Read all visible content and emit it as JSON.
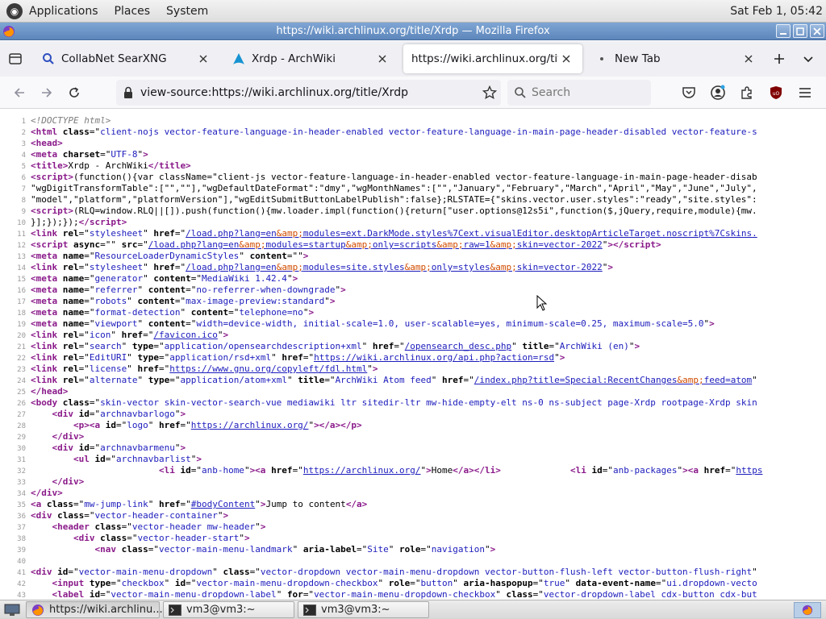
{
  "panel": {
    "menus": [
      "Applications",
      "Places",
      "System"
    ],
    "clock": "Sat Feb  1, 05:42"
  },
  "window": {
    "title": "https://wiki.archlinux.org/title/Xrdp — Mozilla Firefox"
  },
  "tabs": [
    {
      "label": "CollabNet SearXNG",
      "icon": "search-icon",
      "active": false
    },
    {
      "label": "Xrdp - ArchWiki",
      "icon": "archwiki-icon",
      "active": false
    },
    {
      "label": "https://wiki.archlinux.org/title/X",
      "icon": "",
      "active": true
    },
    {
      "label": "New Tab",
      "icon": "dot-icon",
      "active": false
    }
  ],
  "navbar": {
    "url": "view-source:https://wiki.archlinux.org/title/Xrdp",
    "search_placeholder": "Search"
  },
  "source_lines": [
    {
      "n": "1",
      "html": "<span class=\"cmt\">&lt;!DOCTYPE html&gt;</span>"
    },
    {
      "n": "2",
      "html": "<span class=\"tag\">&lt;html</span> <span class=\"attr\">class</span>=\"<span class=\"val\">client-nojs vector-feature-language-in-header-enabled vector-feature-language-in-main-page-header-disabled vector-feature-s</span>"
    },
    {
      "n": "3",
      "html": "<span class=\"tag\">&lt;head&gt;</span>"
    },
    {
      "n": "4",
      "html": "<span class=\"tag\">&lt;meta</span> <span class=\"attr\">charset</span>=\"<span class=\"val\">UTF-8</span>\"<span class=\"tag\">&gt;</span>"
    },
    {
      "n": "5",
      "html": "<span class=\"tag\">&lt;title&gt;</span>Xrdp - ArchWiki<span class=\"tag\">&lt;/title&gt;</span>"
    },
    {
      "n": "6",
      "html": "<span class=\"tag\">&lt;script&gt;</span>(function(){var className=\"client-js vector-feature-language-in-header-enabled vector-feature-language-in-main-page-header-disab"
    },
    {
      "n": "7",
      "html": "\"wgDigitTransformTable\":[\"\",\"\"],\"wgDefaultDateFormat\":\"dmy\",\"wgMonthNames\":[\"\",\"January\",\"February\",\"March\",\"April\",\"May\",\"June\",\"July\","
    },
    {
      "n": "8",
      "html": "\"model\",\"platform\",\"platformVersion\"],\"wgEditSubmitButtonLabelPublish\":false};RLSTATE={\"skins.vector.user.styles\":\"ready\",\"site.styles\":"
    },
    {
      "n": "9",
      "html": "<span class=\"tag\">&lt;script&gt;</span>(RLQ=window.RLQ||[]).push(function(){mw.loader.impl(function(){return[\"user.options@12s5i\",function($,jQuery,require,module){mw."
    },
    {
      "n": "10",
      "html": "}];});});<span class=\"tag\">&lt;/script&gt;</span>"
    },
    {
      "n": "11",
      "html": "<span class=\"tag\">&lt;link</span> <span class=\"attr\">rel</span>=\"<span class=\"val\">stylesheet</span>\" <span class=\"attr\">href</span>=\"<span class=\"link\">/load.php?lang=en<span class=\"ent\">&amp;amp;</span>modules=ext.DarkMode.styles%7Cext.visualEditor.desktopArticleTarget.noscript%7Cskins.</span>"
    },
    {
      "n": "12",
      "html": "<span class=\"tag\">&lt;script</span> <span class=\"attr\">async</span>=\"\" <span class=\"attr\">src</span>=\"<span class=\"link\">/load.php?lang=en<span class=\"ent\">&amp;amp;</span>modules=startup<span class=\"ent\">&amp;amp;</span>only=scripts<span class=\"ent\">&amp;amp;</span>raw=1<span class=\"ent\">&amp;amp;</span>skin=vector-2022</span>\"<span class=\"tag\">&gt;&lt;/script&gt;</span>"
    },
    {
      "n": "13",
      "html": "<span class=\"tag\">&lt;meta</span> <span class=\"attr\">name</span>=\"<span class=\"val\">ResourceLoaderDynamicStyles</span>\" <span class=\"attr\">content</span>=\"\"<span class=\"tag\">&gt;</span>"
    },
    {
      "n": "14",
      "html": "<span class=\"tag\">&lt;link</span> <span class=\"attr\">rel</span>=\"<span class=\"val\">stylesheet</span>\" <span class=\"attr\">href</span>=\"<span class=\"link\">/load.php?lang=en<span class=\"ent\">&amp;amp;</span>modules=site.styles<span class=\"ent\">&amp;amp;</span>only=styles<span class=\"ent\">&amp;amp;</span>skin=vector-2022</span>\"<span class=\"tag\">&gt;</span>"
    },
    {
      "n": "15",
      "html": "<span class=\"tag\">&lt;meta</span> <span class=\"attr\">name</span>=\"<span class=\"val\">generator</span>\" <span class=\"attr\">content</span>=\"<span class=\"val\">MediaWiki 1.42.4</span>\"<span class=\"tag\">&gt;</span>"
    },
    {
      "n": "16",
      "html": "<span class=\"tag\">&lt;meta</span> <span class=\"attr\">name</span>=\"<span class=\"val\">referrer</span>\" <span class=\"attr\">content</span>=\"<span class=\"val\">no-referrer-when-downgrade</span>\"<span class=\"tag\">&gt;</span>"
    },
    {
      "n": "17",
      "html": "<span class=\"tag\">&lt;meta</span> <span class=\"attr\">name</span>=\"<span class=\"val\">robots</span>\" <span class=\"attr\">content</span>=\"<span class=\"val\">max-image-preview:standard</span>\"<span class=\"tag\">&gt;</span>"
    },
    {
      "n": "18",
      "html": "<span class=\"tag\">&lt;meta</span> <span class=\"attr\">name</span>=\"<span class=\"val\">format-detection</span>\" <span class=\"attr\">content</span>=\"<span class=\"val\">telephone=no</span>\"<span class=\"tag\">&gt;</span>"
    },
    {
      "n": "19",
      "html": "<span class=\"tag\">&lt;meta</span> <span class=\"attr\">name</span>=\"<span class=\"val\">viewport</span>\" <span class=\"attr\">content</span>=\"<span class=\"val\">width=device-width, initial-scale=1.0, user-scalable=yes, minimum-scale=0.25, maximum-scale=5.0</span>\"<span class=\"tag\">&gt;</span>"
    },
    {
      "n": "20",
      "html": "<span class=\"tag\">&lt;link</span> <span class=\"attr\">rel</span>=\"<span class=\"val\">icon</span>\" <span class=\"attr\">href</span>=\"<span class=\"link\">/favicon.ico</span>\"<span class=\"tag\">&gt;</span>"
    },
    {
      "n": "21",
      "html": "<span class=\"tag\">&lt;link</span> <span class=\"attr\">rel</span>=\"<span class=\"val\">search</span>\" <span class=\"attr\">type</span>=\"<span class=\"val\">application/opensearchdescription+xml</span>\" <span class=\"attr\">href</span>=\"<span class=\"link\">/opensearch_desc.php</span>\" <span class=\"attr\">title</span>=\"<span class=\"val\">ArchWiki (en)</span>\"<span class=\"tag\">&gt;</span>"
    },
    {
      "n": "22",
      "html": "<span class=\"tag\">&lt;link</span> <span class=\"attr\">rel</span>=\"<span class=\"val\">EditURI</span>\" <span class=\"attr\">type</span>=\"<span class=\"val\">application/rsd+xml</span>\" <span class=\"attr\">href</span>=\"<span class=\"link\">https://wiki.archlinux.org/api.php?action=rsd</span>\"<span class=\"tag\">&gt;</span>"
    },
    {
      "n": "23",
      "html": "<span class=\"tag\">&lt;link</span> <span class=\"attr\">rel</span>=\"<span class=\"val\">license</span>\" <span class=\"attr\">href</span>=\"<span class=\"link\">https://www.gnu.org/copyleft/fdl.html</span>\"<span class=\"tag\">&gt;</span>"
    },
    {
      "n": "24",
      "html": "<span class=\"tag\">&lt;link</span> <span class=\"attr\">rel</span>=\"<span class=\"val\">alternate</span>\" <span class=\"attr\">type</span>=\"<span class=\"val\">application/atom+xml</span>\" <span class=\"attr\">title</span>=\"<span class=\"val\">ArchWiki Atom feed</span>\" <span class=\"attr\">href</span>=\"<span class=\"link\">/index.php?title=Special:RecentChanges<span class=\"ent\">&amp;amp;</span>feed=atom</span>\""
    },
    {
      "n": "25",
      "html": "<span class=\"tag\">&lt;/head&gt;</span>"
    },
    {
      "n": "26",
      "html": "<span class=\"tag\">&lt;body</span> <span class=\"attr\">class</span>=\"<span class=\"val\">skin-vector skin-vector-search-vue mediawiki ltr sitedir-ltr mw-hide-empty-elt ns-0 ns-subject page-Xrdp rootpage-Xrdp skin</span>"
    },
    {
      "n": "27",
      "html": "    <span class=\"tag\">&lt;div</span> <span class=\"attr\">id</span>=\"<span class=\"val\">archnavbarlogo</span>\"<span class=\"tag\">&gt;</span>"
    },
    {
      "n": "28",
      "html": "        <span class=\"tag\">&lt;p&gt;&lt;a</span> <span class=\"attr\">id</span>=\"<span class=\"val\">logo</span>\" <span class=\"attr\">href</span>=\"<span class=\"link\">https://archlinux.org/</span>\"<span class=\"tag\">&gt;&lt;/a&gt;&lt;/p&gt;</span>"
    },
    {
      "n": "29",
      "html": "    <span class=\"tag\">&lt;/div&gt;</span>"
    },
    {
      "n": "30",
      "html": "    <span class=\"tag\">&lt;div</span> <span class=\"attr\">id</span>=\"<span class=\"val\">archnavbarmenu</span>\"<span class=\"tag\">&gt;</span>"
    },
    {
      "n": "31",
      "html": "        <span class=\"tag\">&lt;ul</span> <span class=\"attr\">id</span>=\"<span class=\"val\">archnavbarlist</span>\"<span class=\"tag\">&gt;</span>"
    },
    {
      "n": "32",
      "html": "                        <span class=\"tag\">&lt;li</span> <span class=\"attr\">id</span>=\"<span class=\"val\">anb-home</span>\"<span class=\"tag\">&gt;&lt;a</span> <span class=\"attr\">href</span>=\"<span class=\"link\">https://archlinux.org/</span>\"<span class=\"tag\">&gt;</span>Home<span class=\"tag\">&lt;/a&gt;&lt;/li&gt;</span>             <span class=\"tag\">&lt;li</span> <span class=\"attr\">id</span>=\"<span class=\"val\">anb-packages</span>\"<span class=\"tag\">&gt;&lt;a</span> <span class=\"attr\">href</span>=\"<span class=\"link\">https</span>"
    },
    {
      "n": "33",
      "html": "    <span class=\"tag\">&lt;/div&gt;</span>"
    },
    {
      "n": "34",
      "html": "<span class=\"tag\">&lt;/div&gt;</span>"
    },
    {
      "n": "35",
      "html": "<span class=\"tag\">&lt;a</span> <span class=\"attr\">class</span>=\"<span class=\"val\">mw-jump-link</span>\" <span class=\"attr\">href</span>=\"<span class=\"link\">#bodyContent</span>\"<span class=\"tag\">&gt;</span>Jump to content<span class=\"tag\">&lt;/a&gt;</span>"
    },
    {
      "n": "36",
      "html": "<span class=\"tag\">&lt;div</span> <span class=\"attr\">class</span>=\"<span class=\"val\">vector-header-container</span>\"<span class=\"tag\">&gt;</span>"
    },
    {
      "n": "37",
      "html": "    <span class=\"tag\">&lt;header</span> <span class=\"attr\">class</span>=\"<span class=\"val\">vector-header mw-header</span>\"<span class=\"tag\">&gt;</span>"
    },
    {
      "n": "38",
      "html": "        <span class=\"tag\">&lt;div</span> <span class=\"attr\">class</span>=\"<span class=\"val\">vector-header-start</span>\"<span class=\"tag\">&gt;</span>"
    },
    {
      "n": "39",
      "html": "            <span class=\"tag\">&lt;nav</span> <span class=\"attr\">class</span>=\"<span class=\"val\">vector-main-menu-landmark</span>\" <span class=\"attr\">aria-label</span>=\"<span class=\"val\">Site</span>\" <span class=\"attr\">role</span>=\"<span class=\"val\">navigation</span>\"<span class=\"tag\">&gt;</span>"
    },
    {
      "n": "40",
      "html": ""
    },
    {
      "n": "41",
      "html": "<span class=\"tag\">&lt;div</span> <span class=\"attr\">id</span>=\"<span class=\"val\">vector-main-menu-dropdown</span>\" <span class=\"attr\">class</span>=\"<span class=\"val\">vector-dropdown vector-main-menu-dropdown vector-button-flush-left vector-button-flush-right</span>\""
    },
    {
      "n": "42",
      "html": "    <span class=\"tag\">&lt;input</span> <span class=\"attr\">type</span>=\"<span class=\"val\">checkbox</span>\" <span class=\"attr\">id</span>=\"<span class=\"val\">vector-main-menu-dropdown-checkbox</span>\" <span class=\"attr\">role</span>=\"<span class=\"val\">button</span>\" <span class=\"attr\">aria-haspopup</span>=\"<span class=\"val\">true</span>\" <span class=\"attr\">data-event-name</span>=\"<span class=\"val\">ui.dropdown-vecto</span>"
    },
    {
      "n": "43",
      "html": "    <span class=\"tag\">&lt;label</span> <span class=\"attr\">id</span>=\"<span class=\"val\">vector-main-menu-dropdown-label</span>\" <span class=\"attr\">for</span>=\"<span class=\"val\">vector-main-menu-dropdown-checkbox</span>\" <span class=\"attr\">class</span>=\"<span class=\"val\">vector-dropdown-label cdx-button cdx-but</span>"
    }
  ],
  "taskbar": {
    "tasks": [
      {
        "label": "https://wiki.archlinu...",
        "icon": "firefox-icon"
      },
      {
        "label": "vm3@vm3:~",
        "icon": "terminal-icon"
      },
      {
        "label": "vm3@vm3:~",
        "icon": "terminal-icon"
      }
    ]
  },
  "colors": {
    "tag": "#8a1a8a",
    "attr_value": "#1c1cbd",
    "entity": "#d14b00",
    "titlebar": "#6f95c6",
    "active_tab": "#ffffff"
  }
}
